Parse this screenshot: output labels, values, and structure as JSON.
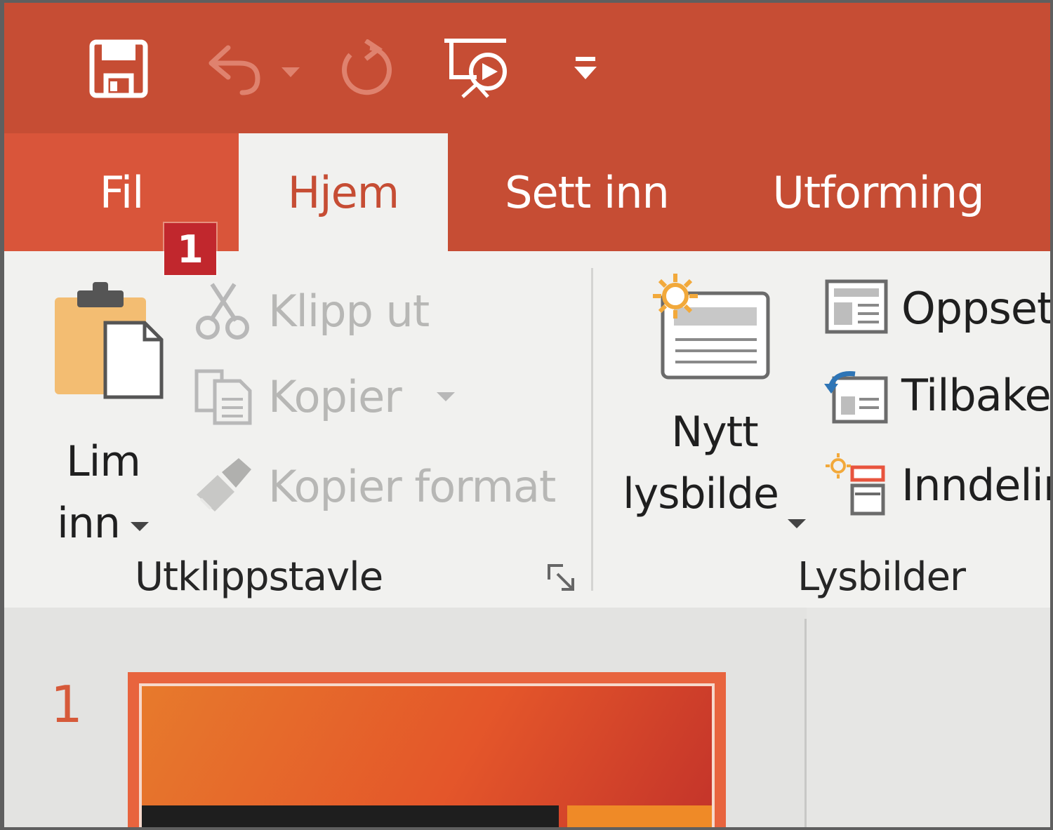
{
  "quick_access": {
    "save": "save-icon",
    "undo": "undo-icon",
    "redo": "redo-icon",
    "slideshow": "slideshow-icon",
    "customize": "customize-toolbar-icon"
  },
  "tabs": {
    "file": "Fil",
    "home": "Hjem",
    "insert": "Sett inn",
    "design": "Utforming"
  },
  "badge": "1",
  "clipboard": {
    "paste_line1": "Lim",
    "paste_line2": "inn",
    "cut": "Klipp ut",
    "copy": "Kopier",
    "format_painter": "Kopier format",
    "group_label": "Utklippstavle"
  },
  "slides": {
    "new_slide_line1": "Nytt",
    "new_slide_line2": "lysbilde",
    "layout": "Oppsett",
    "reset": "Tilbakes",
    "section": "Inndeling",
    "group_label": "Lysbilder"
  },
  "thumbnail": {
    "number": "1"
  },
  "colors": {
    "title_bar": "#c64d34",
    "file_tab": "#d9553a",
    "ribbon": "#f1f1ef",
    "badge": "#c1272d"
  }
}
